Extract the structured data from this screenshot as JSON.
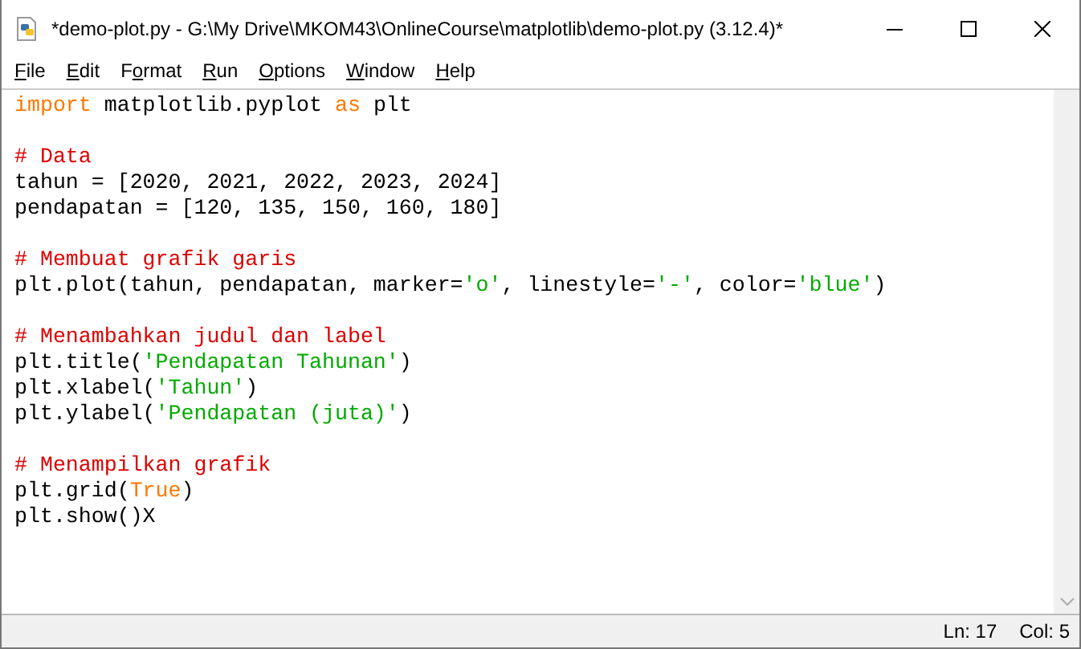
{
  "window": {
    "title": "*demo-plot.py - G:\\My Drive\\MKOM43\\OnlineCourse\\matplotlib\\demo-plot.py (3.12.4)*"
  },
  "menu": [
    {
      "key": "F",
      "after": "ile"
    },
    {
      "key": "E",
      "after": "dit"
    },
    {
      "before": "F",
      "key": "o",
      "after": "rmat"
    },
    {
      "key": "R",
      "after": "un"
    },
    {
      "key": "O",
      "after": "ptions"
    },
    {
      "key": "W",
      "after": "indow"
    },
    {
      "key": "H",
      "after": "elp"
    }
  ],
  "code": [
    {
      "kind": "code",
      "tokens": [
        {
          "kind": "keyword",
          "text": "import"
        },
        {
          "kind": "plain",
          "text": " matplotlib.pyplot "
        },
        {
          "kind": "keyword",
          "text": "as"
        },
        {
          "kind": "plain",
          "text": " plt"
        }
      ]
    },
    {
      "kind": "blank"
    },
    {
      "kind": "code",
      "tokens": [
        {
          "kind": "comment",
          "text": "# Data"
        }
      ]
    },
    {
      "kind": "code",
      "tokens": [
        {
          "kind": "plain",
          "text": "tahun = [2020, 2021, 2022, 2023, 2024]"
        }
      ]
    },
    {
      "kind": "code",
      "tokens": [
        {
          "kind": "plain",
          "text": "pendapatan = [120, 135, 150, 160, 180]"
        }
      ]
    },
    {
      "kind": "blank"
    },
    {
      "kind": "code",
      "tokens": [
        {
          "kind": "comment",
          "text": "# Membuat grafik garis"
        }
      ]
    },
    {
      "kind": "code",
      "tokens": [
        {
          "kind": "plain",
          "text": "plt.plot(tahun, pendapatan, marker="
        },
        {
          "kind": "string",
          "text": "'o'"
        },
        {
          "kind": "plain",
          "text": ", linestyle="
        },
        {
          "kind": "string",
          "text": "'-'"
        },
        {
          "kind": "plain",
          "text": ", color="
        },
        {
          "kind": "string",
          "text": "'blue'"
        },
        {
          "kind": "plain",
          "text": ")"
        }
      ]
    },
    {
      "kind": "blank"
    },
    {
      "kind": "code",
      "tokens": [
        {
          "kind": "comment",
          "text": "# Menambahkan judul dan label"
        }
      ]
    },
    {
      "kind": "code",
      "tokens": [
        {
          "kind": "plain",
          "text": "plt.title("
        },
        {
          "kind": "string",
          "text": "'Pendapatan Tahunan'"
        },
        {
          "kind": "plain",
          "text": ")"
        }
      ]
    },
    {
      "kind": "code",
      "tokens": [
        {
          "kind": "plain",
          "text": "plt.xlabel("
        },
        {
          "kind": "string",
          "text": "'Tahun'"
        },
        {
          "kind": "plain",
          "text": ")"
        }
      ]
    },
    {
      "kind": "code",
      "tokens": [
        {
          "kind": "plain",
          "text": "plt.ylabel("
        },
        {
          "kind": "string",
          "text": "'Pendapatan (juta)'"
        },
        {
          "kind": "plain",
          "text": ")"
        }
      ]
    },
    {
      "kind": "blank"
    },
    {
      "kind": "code",
      "tokens": [
        {
          "kind": "comment",
          "text": "# Menampilkan grafik"
        }
      ]
    },
    {
      "kind": "code",
      "tokens": [
        {
          "kind": "plain",
          "text": "plt.grid("
        },
        {
          "kind": "keyword",
          "text": "True"
        },
        {
          "kind": "plain",
          "text": ")"
        }
      ]
    },
    {
      "kind": "code",
      "tokens": [
        {
          "kind": "plain",
          "text": "plt.show()X"
        }
      ]
    }
  ],
  "status_bar": {
    "line": "Ln: 17",
    "column": "Col: 5"
  }
}
